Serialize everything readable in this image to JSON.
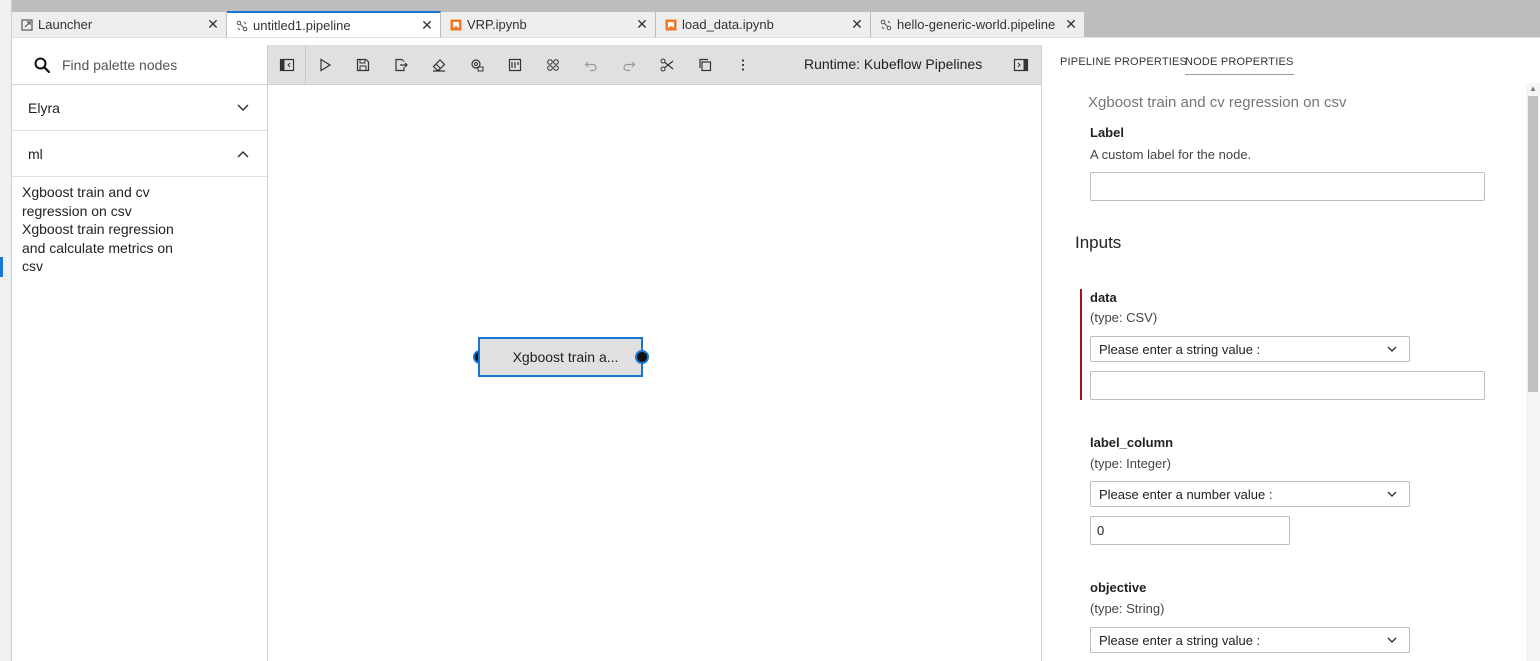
{
  "tabs": [
    {
      "label": "Launcher",
      "icon": "launcher-icon"
    },
    {
      "label": "untitled1.pipeline",
      "icon": "pipeline-icon",
      "active": true
    },
    {
      "label": "VRP.ipynb",
      "icon": "notebook-icon"
    },
    {
      "label": "load_data.ipynb",
      "icon": "notebook-icon"
    },
    {
      "label": "hello-generic-world.pipeline",
      "icon": "pipeline-icon"
    }
  ],
  "palette": {
    "search_placeholder": "Find palette nodes",
    "categories": [
      {
        "label": "Elyra",
        "expanded": false
      },
      {
        "label": "ml",
        "expanded": true
      }
    ],
    "nodes": [
      "Xgboost train and cv regression on csv",
      "Xgboost train regression and calculate metrics on csv"
    ]
  },
  "toolbar": {
    "runtime": "Runtime: Kubeflow Pipelines"
  },
  "canvas": {
    "node_label": "Xgboost train a..."
  },
  "properties": {
    "tabs": [
      "PIPELINE PROPERTIES",
      "NODE PROPERTIES"
    ],
    "node_title": "Xgboost train and cv regression on csv",
    "label_field": {
      "label": "Label",
      "description": "A custom label for the node.",
      "value": ""
    },
    "inputs_heading": "Inputs",
    "inputs": [
      {
        "name": "data",
        "type": "(type: CSV)",
        "select": "Please enter a string value :",
        "value": ""
      },
      {
        "name": "label_column",
        "type": "(type: Integer)",
        "select": "Please enter a number value :",
        "value": "0"
      },
      {
        "name": "objective",
        "type": "(type: String)",
        "select": "Please enter a string value :"
      }
    ]
  },
  "colors": {
    "accent": "#1976d2",
    "error": "#a31515"
  }
}
